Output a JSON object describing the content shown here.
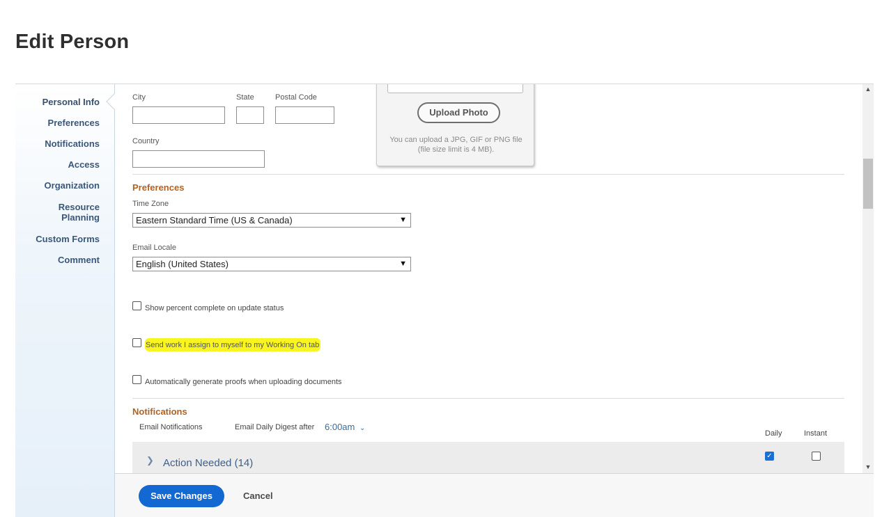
{
  "page": {
    "title": "Edit Person"
  },
  "sidebar": {
    "items": [
      {
        "label": "Personal Info"
      },
      {
        "label": "Preferences"
      },
      {
        "label": "Notifications"
      },
      {
        "label": "Access"
      },
      {
        "label": "Organization"
      },
      {
        "label": "Resource\nPlanning"
      },
      {
        "label": "Custom Forms"
      },
      {
        "label": "Comment"
      }
    ],
    "active_item": "Personal Info"
  },
  "address": {
    "city_label": "City",
    "city_value": "",
    "state_label": "State",
    "state_value": "",
    "postal_label": "Postal Code",
    "postal_value": "",
    "country_label": "Country",
    "country_value": ""
  },
  "photo": {
    "upload_label": "Upload Photo",
    "hint": "You can upload a JPG, GIF or PNG file (file size limit is 4 MB)."
  },
  "preferences": {
    "title": "Preferences",
    "timezone_label": "Time Zone",
    "timezone_value": "Eastern Standard Time (US & Canada)",
    "locale_label": "Email Locale",
    "locale_value": "English (United States)",
    "options": [
      {
        "label": "Show percent complete on update status",
        "checked": false,
        "highlighted": false
      },
      {
        "label": "Send work I assign to myself to my Working On tab",
        "checked": false,
        "highlighted": true
      },
      {
        "label": "Automatically generate proofs when uploading documents",
        "checked": false,
        "highlighted": false
      }
    ]
  },
  "notifications": {
    "title": "Notifications",
    "email_label": "Email Notifications",
    "digest_label": "Email Daily Digest after",
    "digest_time": "6:00am",
    "col_daily": "Daily",
    "col_instant": "Instant",
    "rows": [
      {
        "label": "Action Needed (14)",
        "daily": true,
        "instant": false
      }
    ]
  },
  "footer": {
    "save_label": "Save Changes",
    "cancel_label": "Cancel"
  },
  "colors": {
    "accent": "#1468d2",
    "section_title": "#b4611f",
    "highlight": "#f8f520",
    "nav_text": "#3a5779"
  }
}
